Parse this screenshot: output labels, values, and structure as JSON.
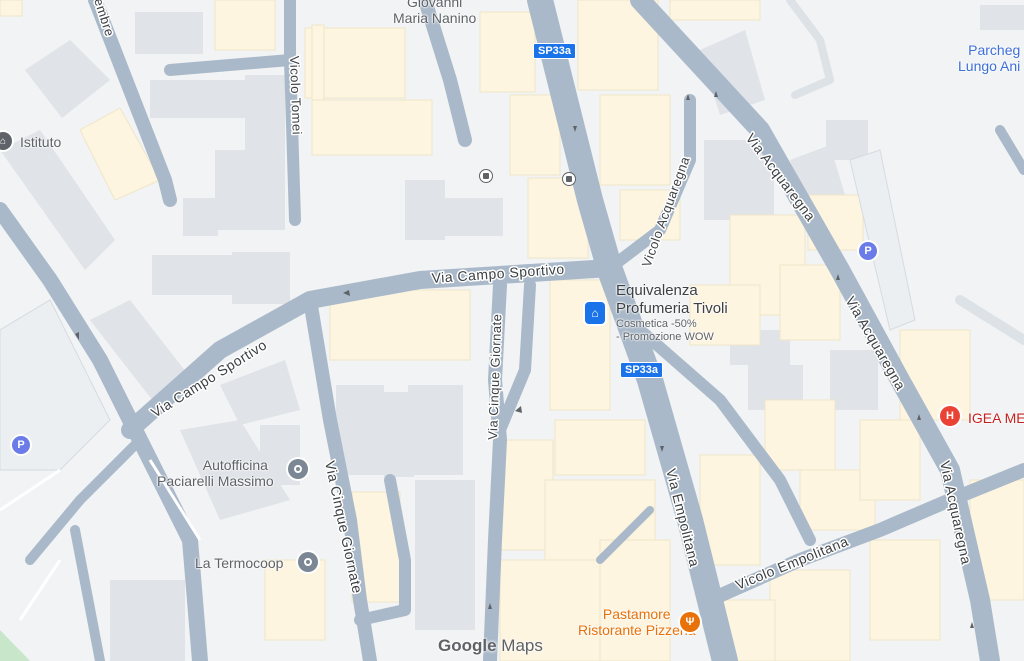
{
  "roads": {
    "via_campo_sportivo_east": "Via Campo Sportivo",
    "via_campo_sportivo_west": "Via Campo Sportivo",
    "vicolo_tomei": "Vicolo Tomei",
    "vicolo_acquaregna": "Vicolo Acquaregna",
    "via_acquaregna_1": "Via Acquaregna",
    "via_acquaregna_2": "Via Acquaregna",
    "via_acquaregna_3": "Via Acquaregna",
    "via_cinque_giornate_1": "Via Cinque Giornate",
    "via_cinque_giornate_2": "Via Cinque Giornate",
    "via_empolitana": "Via Empolitana",
    "vicolo_empolitana": "Vicolo Empolitana",
    "via_settembre_partial": "embre"
  },
  "shields": {
    "sp33a_top": "SP33a",
    "sp33a_mid": "SP33a"
  },
  "pois": {
    "giovanni_line1": "Giovanni",
    "giovanni_line2": "Maria Nanino",
    "istituto": "Istituto",
    "parcheggio_line1": "Parcheg",
    "parcheggio_line2": "Lungo Ani",
    "equivalenza_line1": "Equivalenza",
    "equivalenza_line2": "Profumeria Tivoli",
    "equivalenza_sub1": "Cosmetica -50%",
    "equivalenza_sub2": "- Promozione WOW",
    "igea": "IGEA ME",
    "autofficina_line1": "Autofficina",
    "autofficina_line2": "Paciarelli Massimo",
    "termocoop": "La Termocoop",
    "pastamore_line1": "Pastamore",
    "pastamore_line2": "Ristorante Pizzeria"
  },
  "icons": {
    "parking": "P",
    "hospital": "H"
  },
  "colors": {
    "background": "#f1f3f4",
    "road": "#aab9c9",
    "building": "#fdf5e0",
    "building_grey": "#e0e3e7",
    "poi_blue": "#1a73e8",
    "hospital_red": "#ea4335",
    "restaurant_orange": "#e8710a",
    "parking_blue": "#6b7ce9"
  },
  "watermark": {
    "google": "Google",
    "maps": "Maps"
  }
}
